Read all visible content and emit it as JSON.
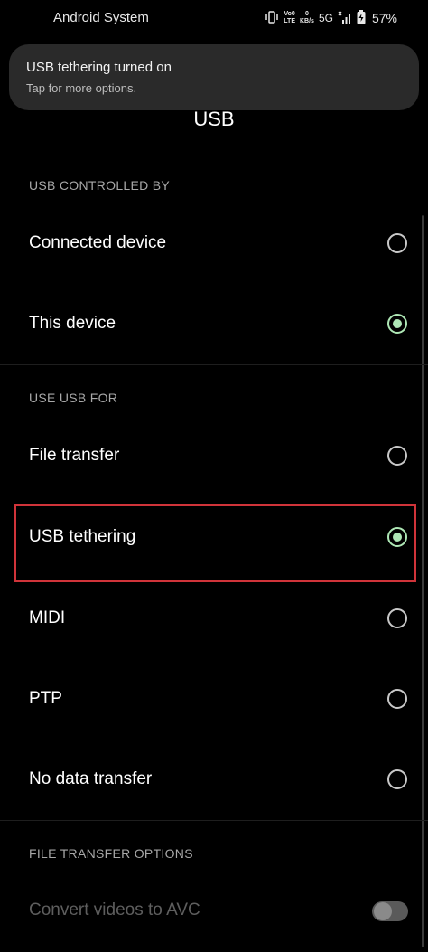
{
  "status_bar": {
    "title": "Android System",
    "network_top": "Vo0",
    "network_bottom": "LTE",
    "speed_top": "0",
    "speed_bottom": "KB/s",
    "network_type": "5G",
    "battery": "57%",
    "icons": [
      "vibrate-icon",
      "signal-icon",
      "battery-charging-icon"
    ]
  },
  "notification": {
    "title": "USB tethering turned on",
    "subtitle": "Tap for more options."
  },
  "page": {
    "title": "USB"
  },
  "sections": {
    "controlled_by": {
      "header": "USB CONTROLLED BY",
      "options": [
        {
          "label": "Connected device",
          "selected": false
        },
        {
          "label": "This device",
          "selected": true
        }
      ]
    },
    "use_for": {
      "header": "USE USB FOR",
      "options": [
        {
          "label": "File transfer",
          "selected": false
        },
        {
          "label": "USB tethering",
          "selected": true
        },
        {
          "label": "MIDI",
          "selected": false
        },
        {
          "label": "PTP",
          "selected": false
        },
        {
          "label": "No data transfer",
          "selected": false
        }
      ]
    },
    "file_transfer_options": {
      "header": "FILE TRANSFER OPTIONS",
      "toggle_label": "Convert videos to AVC",
      "toggle_on": false,
      "enabled": false
    }
  },
  "colors": {
    "background": "#000000",
    "accent": "#aee7b5",
    "highlight": "#d0343a",
    "notification_bg": "#2a2a2a"
  }
}
